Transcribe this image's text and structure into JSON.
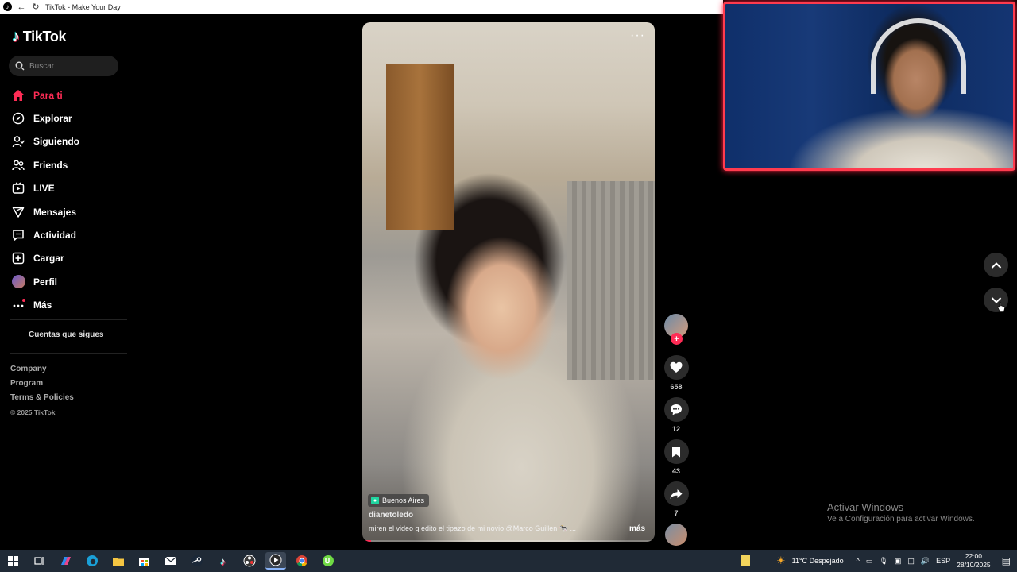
{
  "browser": {
    "title": "TikTok - Make Your Day"
  },
  "sidebar": {
    "logo": "TikTok",
    "search_placeholder": "Buscar",
    "items": [
      {
        "label": "Para ti",
        "icon": "home-icon",
        "active": true
      },
      {
        "label": "Explorar",
        "icon": "compass-icon",
        "active": false
      },
      {
        "label": "Siguiendo",
        "icon": "following-icon",
        "active": false
      },
      {
        "label": "Friends",
        "icon": "friends-icon",
        "active": false
      },
      {
        "label": "LIVE",
        "icon": "live-icon",
        "active": false
      },
      {
        "label": "Mensajes",
        "icon": "messages-icon",
        "active": false
      },
      {
        "label": "Actividad",
        "icon": "activity-icon",
        "active": false
      },
      {
        "label": "Cargar",
        "icon": "upload-icon",
        "active": false
      },
      {
        "label": "Perfil",
        "icon": "avatar",
        "active": false
      },
      {
        "label": "Más",
        "icon": "more-icon",
        "active": false
      }
    ],
    "following_accounts_label": "Cuentas que sigues",
    "footer": {
      "company": "Company",
      "program": "Program",
      "terms": "Terms & Policies",
      "copyright": "© 2025 TikTok"
    }
  },
  "video": {
    "location": "Buenos Aires",
    "author": "dianetoledo",
    "caption": "miren el video q edito el tipazo de mi novio @Marco Guillen 🐄 ...",
    "more_label": "más",
    "progress_fraction": 0.03
  },
  "actions": {
    "likes": "658",
    "comments": "12",
    "saves": "43",
    "shares": "7"
  },
  "overlay": {
    "activate_title": "Activar Windows",
    "activate_subtitle": "Ve a Configuración para activar Windows."
  },
  "taskbar": {
    "weather": "11°C  Despejado",
    "language": "ESP",
    "time": "22:00",
    "date": "28/10/2025"
  },
  "colors": {
    "accent": "#fe2c55",
    "background": "#000000",
    "webcam_border": "#ff3b4e"
  }
}
